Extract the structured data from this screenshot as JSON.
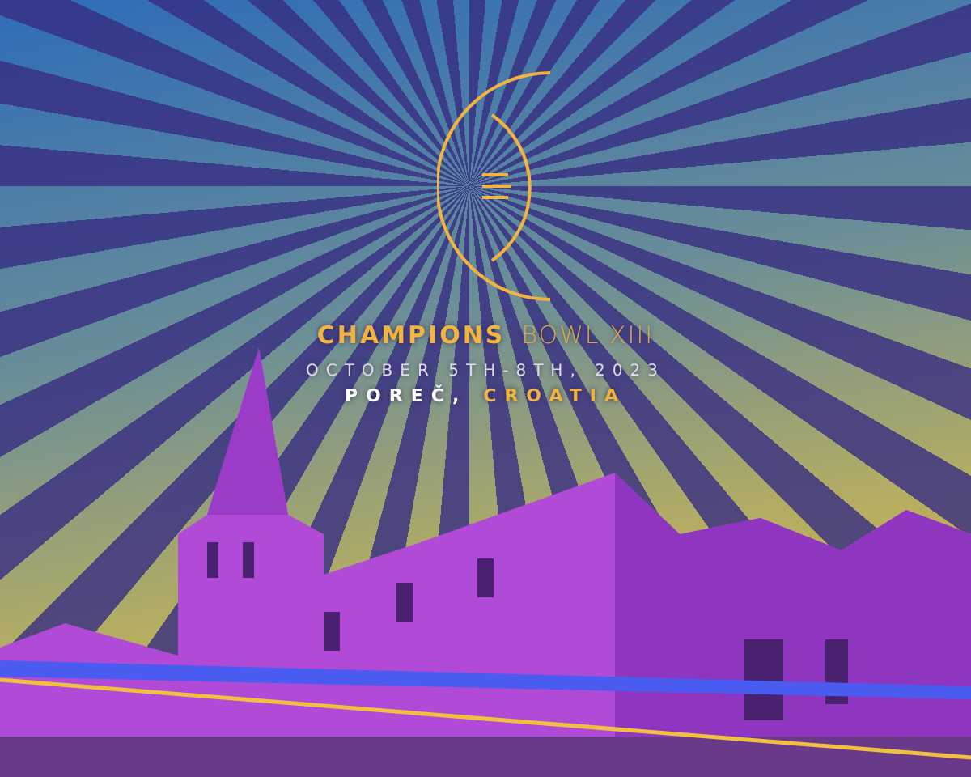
{
  "title": {
    "primary": "CHAMPIONS",
    "secondary": "BOWL XIII"
  },
  "date": "OCTOBER 5TH-8TH, 2023",
  "location": {
    "city": "POREČ,",
    "country": "CROATIA"
  }
}
